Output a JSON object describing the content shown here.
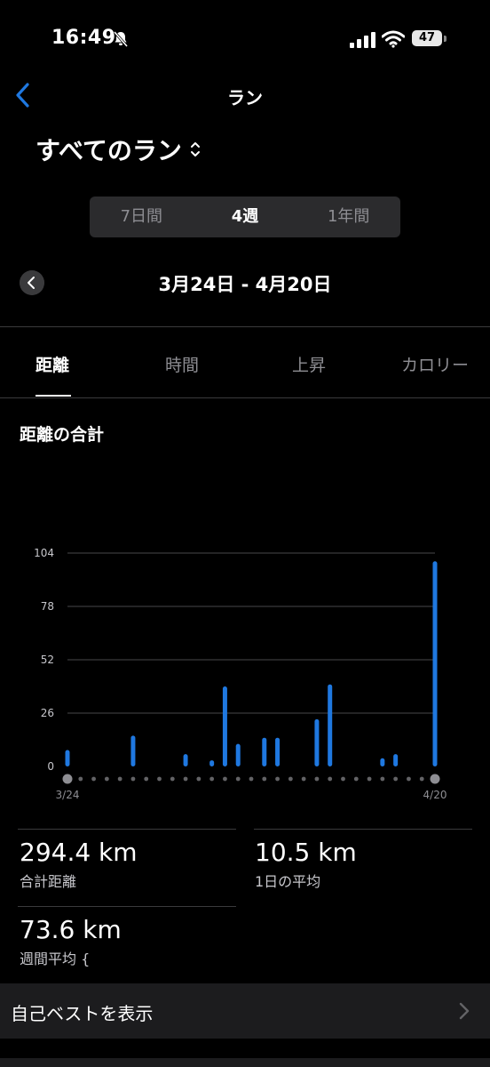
{
  "status": {
    "time": "16:49",
    "battery": "47"
  },
  "nav": {
    "title": "ラン"
  },
  "selector": {
    "label": "すべてのラン"
  },
  "segments": [
    "7日間",
    "4週",
    "1年間"
  ],
  "date_range": "3月24日 - 4月20日",
  "metric_tabs": [
    "距離",
    "時間",
    "上昇",
    "カロリー"
  ],
  "section_title": "距離の合計",
  "chart_data": {
    "type": "bar",
    "x_start_label": "3/24",
    "x_end_label": "4/20",
    "yticks": [
      0,
      26,
      52,
      78,
      104
    ],
    "ylim": [
      0,
      104
    ],
    "values": [
      8,
      0,
      0,
      0,
      0,
      15,
      0,
      0,
      0,
      6,
      0,
      3,
      39,
      11,
      0,
      14,
      14,
      0,
      0,
      23,
      40,
      0,
      0,
      0,
      4,
      6,
      0,
      0,
      100
    ],
    "bar_color": "#1f78e0"
  },
  "stats": {
    "total": {
      "value": "294.4 km",
      "label": "合計距離"
    },
    "daily_avg": {
      "value": "10.5 km",
      "label": "1日の平均"
    },
    "weekly_avg": {
      "value": "73.6 km",
      "label": "週間平均 {"
    }
  },
  "best": {
    "label": "自己ベストを表示"
  }
}
